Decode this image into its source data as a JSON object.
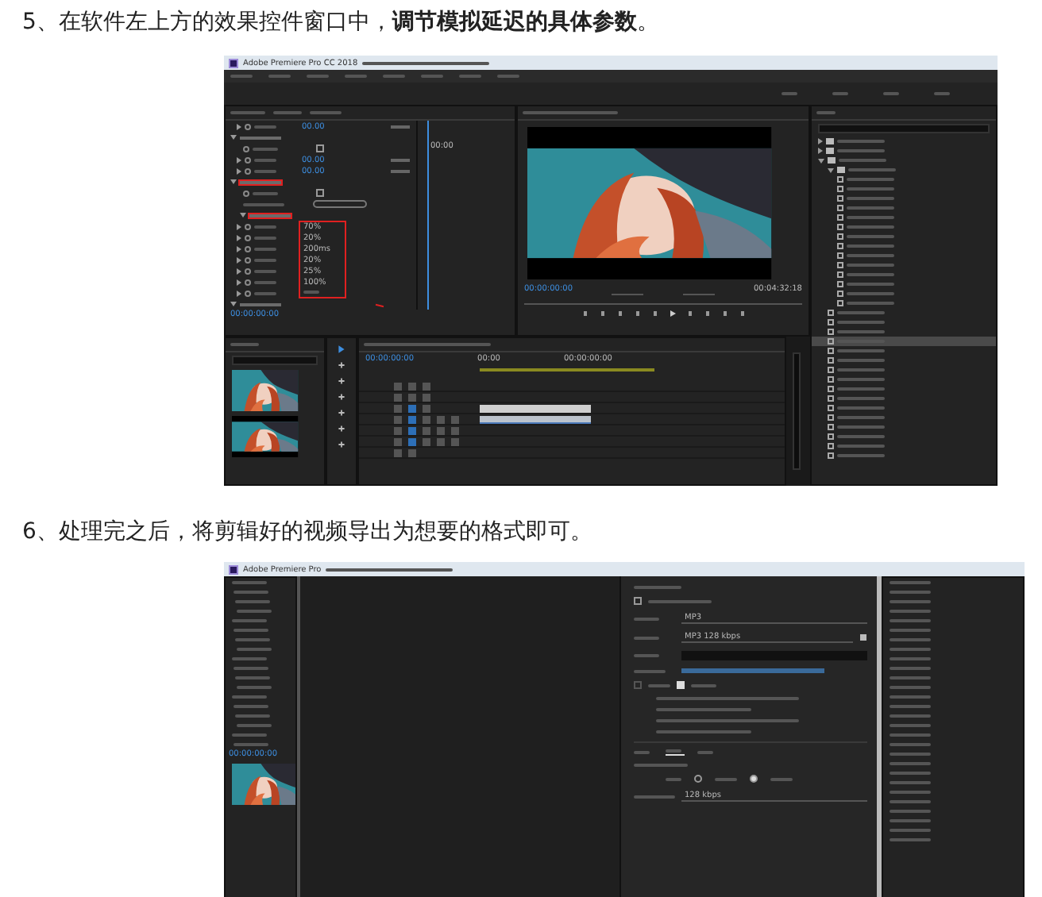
{
  "steps": [
    {
      "heading": "5、在软件左上方的效果控件窗口中，**调节模拟延迟的具体参数**。",
      "screenshot": {
        "kind": "editing",
        "app_title": "Adobe Premiere Pro CC 2018",
        "controls_time": "00:00",
        "controls_footer_time": "00:00:00:00",
        "property_rows": [
          {
            "kind": "param",
            "value": "00.00"
          },
          {
            "kind": "group"
          },
          {
            "kind": "toggle",
            "checked": false
          },
          {
            "kind": "param",
            "value": "00.00"
          },
          {
            "kind": "param",
            "value": "00.00"
          },
          {
            "kind": "group",
            "marked": true
          },
          {
            "kind": "toggle",
            "checked": false
          },
          {
            "kind": "custom"
          },
          {
            "kind": "subgroup",
            "marked": true
          },
          {
            "kind": "param",
            "value": "70%",
            "boxed": true
          },
          {
            "kind": "param",
            "value": "20%",
            "boxed": true
          },
          {
            "kind": "param",
            "value": "200ms",
            "boxed": true
          },
          {
            "kind": "param",
            "value": "20%",
            "boxed": true
          },
          {
            "kind": "param",
            "value": "25%",
            "boxed": true
          },
          {
            "kind": "param",
            "value": "100%",
            "boxed": true
          },
          {
            "kind": "param",
            "boxed": true
          },
          {
            "kind": "group"
          }
        ],
        "monitor_time": "00:00:00:00",
        "monitor_duration": "00:04:32:18",
        "timeline_time": "00:00:00:00",
        "ruler_labels": [
          "00:00",
          "00:00:00:00"
        ],
        "tracks": [
          {
            "kind": "video",
            "clip": false
          },
          {
            "kind": "video",
            "clip": false
          },
          {
            "kind": "video",
            "clip": true
          },
          {
            "kind": "audio",
            "clip": true
          },
          {
            "kind": "audio",
            "clip": false
          },
          {
            "kind": "audio",
            "clip": false
          },
          {
            "kind": "master",
            "clip": false
          }
        ],
        "effects_tree": [
          {
            "kind": "folder",
            "expanded": false,
            "selected": false
          },
          {
            "kind": "folder",
            "expanded": false,
            "selected": false
          },
          {
            "kind": "folder",
            "expanded": true,
            "selected": false,
            "children": [
              {
                "kind": "folder",
                "expanded": true,
                "selected": false,
                "children": [
                  {
                    "kind": "effect",
                    "selected": false
                  },
                  {
                    "kind": "effect",
                    "selected": false
                  },
                  {
                    "kind": "effect",
                    "selected": false
                  },
                  {
                    "kind": "effect",
                    "selected": false
                  },
                  {
                    "kind": "effect",
                    "selected": false
                  },
                  {
                    "kind": "effect",
                    "selected": false
                  },
                  {
                    "kind": "effect",
                    "selected": false
                  },
                  {
                    "kind": "effect",
                    "selected": false
                  },
                  {
                    "kind": "effect",
                    "selected": false
                  },
                  {
                    "kind": "effect",
                    "selected": false
                  },
                  {
                    "kind": "effect",
                    "selected": false
                  },
                  {
                    "kind": "effect",
                    "selected": false
                  },
                  {
                    "kind": "effect",
                    "selected": false
                  },
                  {
                    "kind": "effect",
                    "selected": false
                  }
                ]
              },
              {
                "kind": "effect",
                "selected": false
              },
              {
                "kind": "effect",
                "selected": false
              },
              {
                "kind": "effect",
                "selected": false
              },
              {
                "kind": "effect",
                "selected": true
              },
              {
                "kind": "effect",
                "selected": false
              },
              {
                "kind": "effect",
                "selected": false
              },
              {
                "kind": "effect",
                "selected": false
              },
              {
                "kind": "effect",
                "selected": false
              },
              {
                "kind": "effect",
                "selected": false
              },
              {
                "kind": "effect",
                "selected": false
              },
              {
                "kind": "effect",
                "selected": false
              },
              {
                "kind": "effect",
                "selected": false
              },
              {
                "kind": "effect",
                "selected": false
              },
              {
                "kind": "effect",
                "selected": false
              },
              {
                "kind": "effect",
                "selected": false
              },
              {
                "kind": "effect",
                "selected": false
              }
            ]
          }
        ]
      }
    },
    {
      "heading": "6、处理完之后，将剪辑好的视频导出为想要的格式即可。",
      "screenshot": {
        "kind": "export",
        "app_title": "Adobe Premiere Pro",
        "timecode": "00:00:00:00",
        "format": "MP3",
        "preset": "MP3 128 kbps",
        "bitrate": "128 kbps",
        "match_sequence": false,
        "export_video": false,
        "export_audio": true,
        "tabs": [
          {
            "selected": false
          },
          {
            "selected": true
          },
          {
            "selected": false
          }
        ],
        "channels": [
          {
            "selected": false
          },
          {
            "selected": true
          }
        ]
      }
    }
  ]
}
